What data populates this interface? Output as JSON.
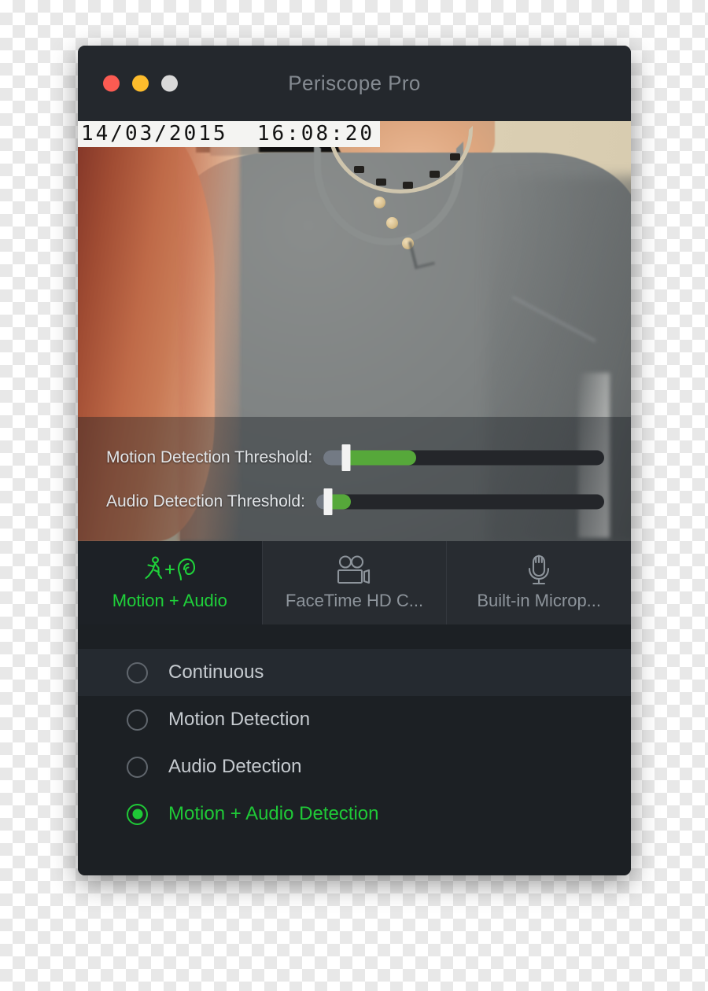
{
  "window": {
    "title": "Periscope Pro",
    "traffic_lights": [
      {
        "name": "close",
        "color": "#fb5b52"
      },
      {
        "name": "minimize",
        "color": "#fdbc2c"
      },
      {
        "name": "zoom",
        "color": "#d9d9d9"
      }
    ]
  },
  "video": {
    "timestamp": "14/03/2015  16:08:20"
  },
  "controls": {
    "motion": {
      "label": "Motion Detection Threshold:",
      "pre_percent": 8,
      "thumb_percent": 8,
      "fill_end_percent": 33
    },
    "audio": {
      "label": "Audio Detection Threshold:",
      "pre_percent": 4,
      "thumb_percent": 4,
      "fill_end_percent": 12
    }
  },
  "tabs": [
    {
      "label": "Motion + Audio",
      "icon": "motion-plus-audio-icon",
      "active": true
    },
    {
      "label": "FaceTime HD C...",
      "icon": "video-camera-icon",
      "active": false
    },
    {
      "label": "Built-in Microp...",
      "icon": "microphone-icon",
      "active": false
    }
  ],
  "modes": [
    {
      "label": "Continuous",
      "selected": false,
      "hover": true
    },
    {
      "label": "Motion Detection",
      "selected": false,
      "hover": false
    },
    {
      "label": "Audio Detection",
      "selected": false,
      "hover": false
    },
    {
      "label": "Motion + Audio Detection",
      "selected": true,
      "hover": false
    }
  ],
  "colors": {
    "accent_green": "#1fc937",
    "slider_green": "#56a83a",
    "window_bg": "#1c2024",
    "titlebar_bg": "#24282d",
    "tab_bg": "#282c31"
  }
}
